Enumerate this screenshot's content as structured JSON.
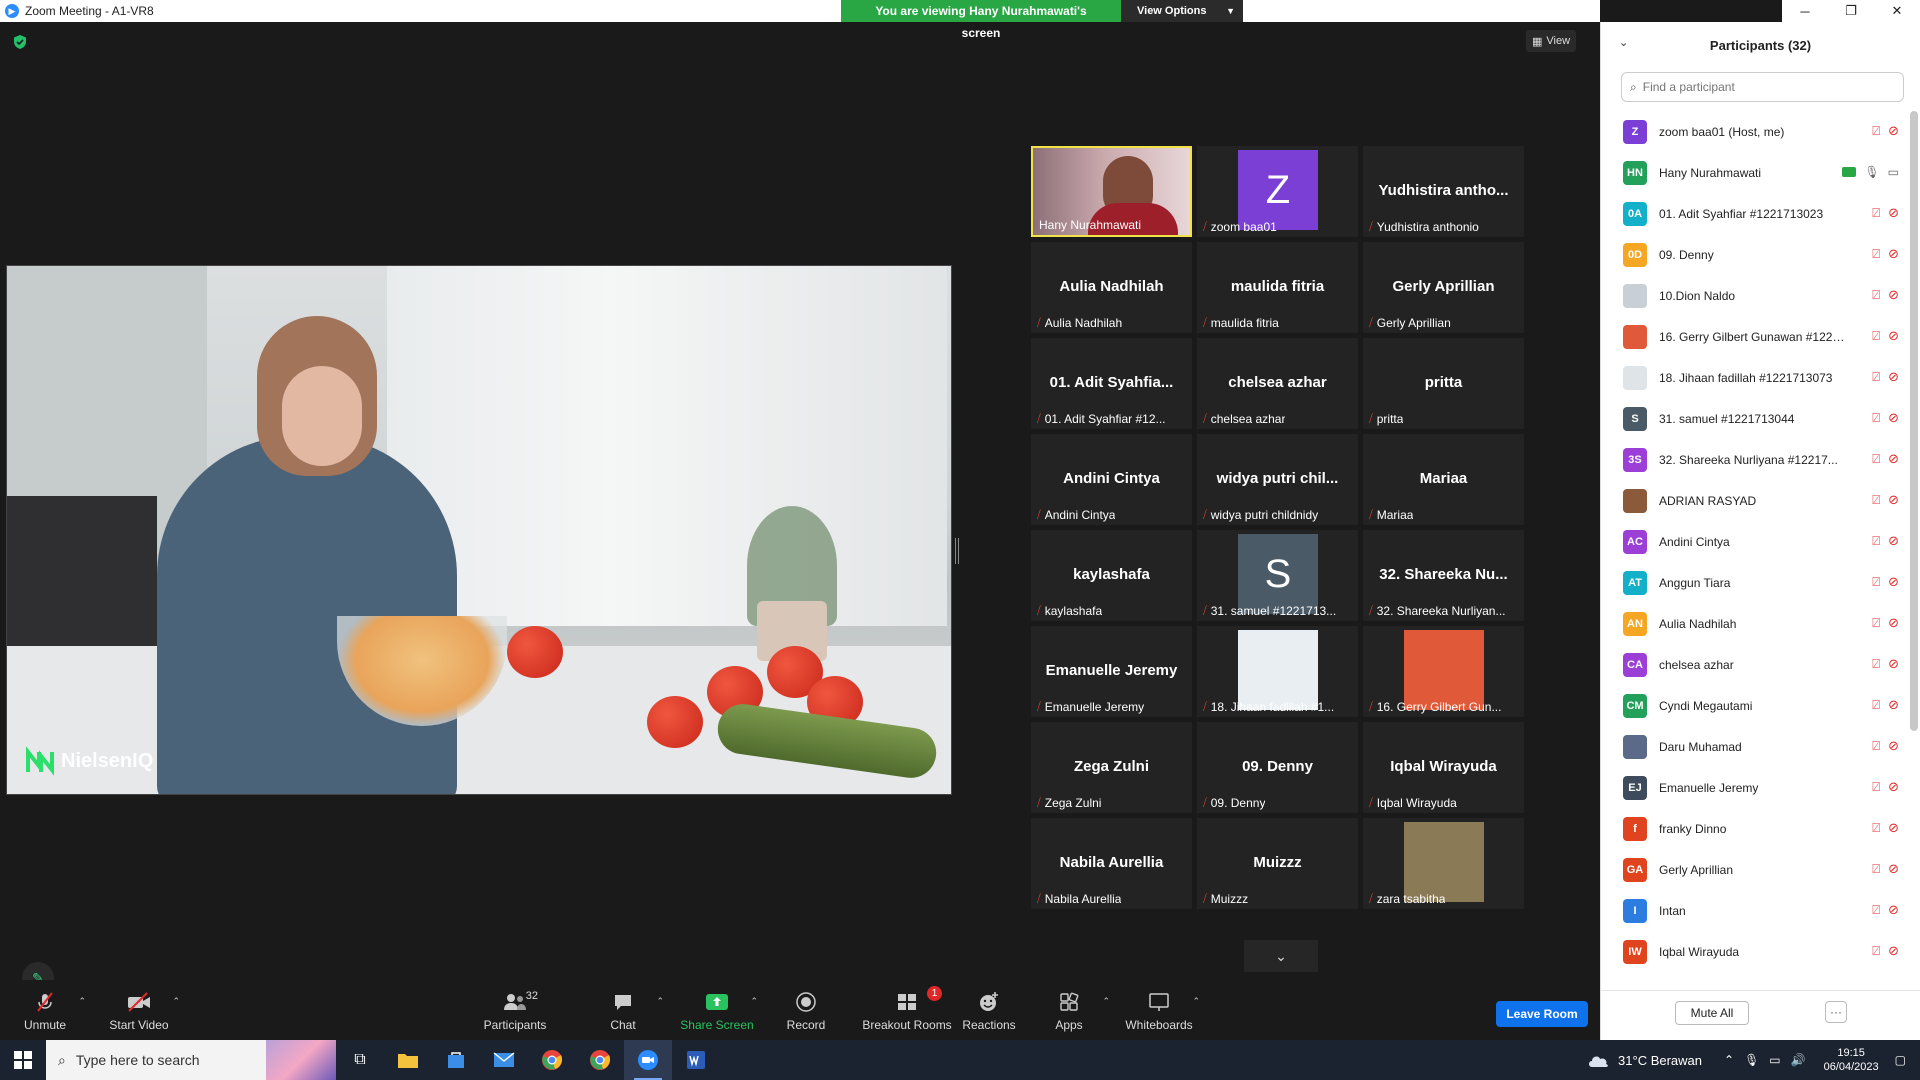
{
  "window": {
    "title": "Zoom Meeting - A1-VR8",
    "minimize": "─",
    "restore": "❐",
    "close": "✕"
  },
  "share_banner": {
    "viewing_text": "You are viewing Hany Nurahmawati's screen",
    "view_options": "View Options"
  },
  "view_button": "View",
  "shared_content": {
    "logo_text": "NielsenIQ"
  },
  "tiles": [
    {
      "big": "",
      "label": "Hany Nurahmawati",
      "muted": false,
      "kind": "photo"
    },
    {
      "big": "",
      "label": "zoom baa01",
      "muted": true,
      "kind": "avatar",
      "avatar": "Z",
      "avatar_color": "#7b3fd6"
    },
    {
      "big": "Yudhistira antho...",
      "label": "Yudhistira anthonio",
      "muted": true,
      "kind": "text"
    },
    {
      "big": "Aulia Nadhilah",
      "label": "Aulia Nadhilah",
      "muted": true,
      "kind": "text"
    },
    {
      "big": "maulida fitria",
      "label": "maulida fitria",
      "muted": true,
      "kind": "text"
    },
    {
      "big": "Gerly Aprillian",
      "label": "Gerly Aprillian",
      "muted": true,
      "kind": "text"
    },
    {
      "big": "01. Adit Syahfia...",
      "label": "01. Adit Syahfiar #12...",
      "muted": true,
      "kind": "text"
    },
    {
      "big": "chelsea azhar",
      "label": "chelsea azhar",
      "muted": true,
      "kind": "text"
    },
    {
      "big": "pritta",
      "label": "pritta",
      "muted": true,
      "kind": "text"
    },
    {
      "big": "Andini Cintya",
      "label": "Andini Cintya",
      "muted": true,
      "kind": "text"
    },
    {
      "big": "widya putri chil...",
      "label": "widya putri childnidy",
      "muted": true,
      "kind": "text"
    },
    {
      "big": "Mariaa",
      "label": "Mariaa",
      "muted": true,
      "kind": "text"
    },
    {
      "big": "kaylashafa",
      "label": "kaylashafa",
      "muted": true,
      "kind": "text"
    },
    {
      "big": "",
      "label": "31. samuel #1221713...",
      "muted": true,
      "kind": "avatar",
      "avatar": "S",
      "avatar_color": "#4a5a66"
    },
    {
      "big": "32. Shareeka Nu...",
      "label": "32. Shareeka Nurliyan...",
      "muted": true,
      "kind": "text"
    },
    {
      "big": "Emanuelle Jeremy",
      "label": "Emanuelle Jeremy",
      "muted": true,
      "kind": "text"
    },
    {
      "big": "",
      "label": "18. Jihaan fadillah #1...",
      "muted": true,
      "kind": "avatar",
      "avatar": "",
      "avatar_color": "#e9eef2"
    },
    {
      "big": "",
      "label": "16. Gerry Gilbert Gun...",
      "muted": true,
      "kind": "avatar",
      "avatar": "",
      "avatar_color": "#e05a3a"
    },
    {
      "big": "Zega Zulni",
      "label": "Zega Zulni",
      "muted": true,
      "kind": "text"
    },
    {
      "big": "09. Denny",
      "label": "09. Denny",
      "muted": true,
      "kind": "text"
    },
    {
      "big": "Iqbal Wirayuda",
      "label": "Iqbal Wirayuda",
      "muted": true,
      "kind": "text"
    },
    {
      "big": "Nabila Aurellia",
      "label": "Nabila Aurellia",
      "muted": true,
      "kind": "text"
    },
    {
      "big": "Muizzz",
      "label": "Muizzz",
      "muted": true,
      "kind": "text"
    },
    {
      "big": "",
      "label": "zara tsabitha",
      "muted": true,
      "kind": "avatar",
      "avatar": "",
      "avatar_color": "#8a7a55"
    }
  ],
  "toolbar": {
    "unmute": "Unmute",
    "start_video": "Start Video",
    "participants": "Participants",
    "participants_count": "32",
    "chat": "Chat",
    "share_screen": "Share Screen",
    "record": "Record",
    "breakout_rooms": "Breakout Rooms",
    "breakout_badge": "1",
    "reactions": "Reactions",
    "apps": "Apps",
    "whiteboards": "Whiteboards",
    "leave_room": "Leave Room"
  },
  "panel": {
    "title": "Participants (32)",
    "search_placeholder": "Find a participant",
    "mute_all": "Mute All",
    "more": "···",
    "participants": [
      {
        "initials": "Z",
        "color": "#7b3fd6",
        "name": "zoom baa01 (Host, me)",
        "sharing": false
      },
      {
        "initials": "HN",
        "color": "#23a05a",
        "name": "Hany Nurahmawati",
        "sharing": true
      },
      {
        "initials": "0A",
        "color": "#14b0c9",
        "name": "01. Adit Syahfiar #1221713023",
        "sharing": false
      },
      {
        "initials": "0D",
        "color": "#f5a623",
        "name": "09. Denny",
        "sharing": false
      },
      {
        "initials": "",
        "color": "#c9cfd6",
        "name": "10.Dion Naldo",
        "sharing": false
      },
      {
        "initials": "",
        "color": "#e05a3a",
        "name": "16. Gerry Gilbert Gunawan #1221713...",
        "sharing": false
      },
      {
        "initials": "",
        "color": "#dfe4e8",
        "name": "18. Jihaan fadillah #1221713073",
        "sharing": false
      },
      {
        "initials": "S",
        "color": "#4a5a66",
        "name": "31. samuel #1221713044",
        "sharing": false
      },
      {
        "initials": "3S",
        "color": "#9b3fd6",
        "name": "32. Shareeka Nurliyana #12217...",
        "sharing": false
      },
      {
        "initials": "",
        "color": "#8a5a3a",
        "name": "ADRIAN RASYAD",
        "sharing": false
      },
      {
        "initials": "AC",
        "color": "#9b3fd6",
        "name": "Andini Cintya",
        "sharing": false
      },
      {
        "initials": "AT",
        "color": "#14b0c9",
        "name": "Anggun Tiara",
        "sharing": false
      },
      {
        "initials": "AN",
        "color": "#f5a623",
        "name": "Aulia Nadhilah",
        "sharing": false
      },
      {
        "initials": "CA",
        "color": "#9b3fd6",
        "name": "chelsea azhar",
        "sharing": false
      },
      {
        "initials": "CM",
        "color": "#23a05a",
        "name": "Cyndi Megautami",
        "sharing": false
      },
      {
        "initials": "",
        "color": "#5a6a88",
        "name": "Daru Muhamad",
        "sharing": false
      },
      {
        "initials": "EJ",
        "color": "#3d4b5c",
        "name": "Emanuelle Jeremy",
        "sharing": false
      },
      {
        "initials": "f",
        "color": "#e0441f",
        "name": "franky Dinno",
        "sharing": false
      },
      {
        "initials": "GA",
        "color": "#e0441f",
        "name": "Gerly Aprillian",
        "sharing": false
      },
      {
        "initials": "I",
        "color": "#2d7de0",
        "name": "Intan",
        "sharing": false
      },
      {
        "initials": "IW",
        "color": "#e0441f",
        "name": "Iqbal Wirayuda",
        "sharing": false
      }
    ]
  },
  "taskbar": {
    "search_placeholder": "Type here to search",
    "weather": "31°C Berawan",
    "time": "19:15",
    "date": "06/04/2023"
  }
}
